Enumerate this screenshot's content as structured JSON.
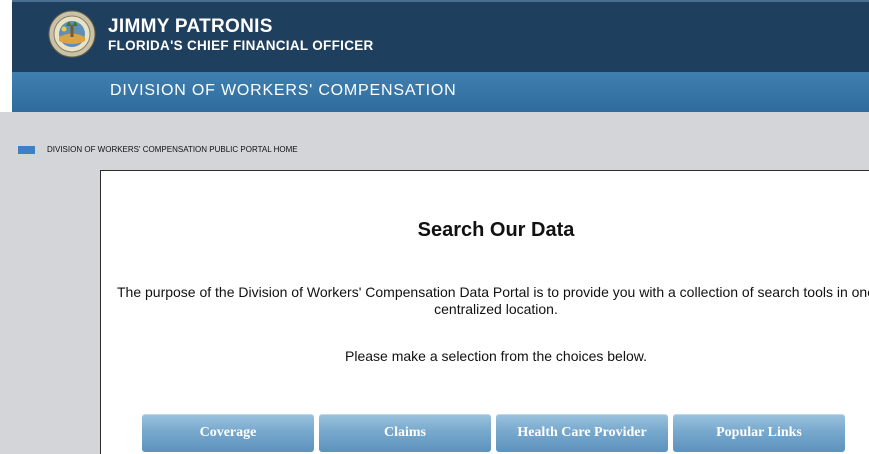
{
  "header": {
    "name": "JIMMY PATRONIS",
    "title": "FLORIDA'S CHIEF FINANCIAL OFFICER",
    "seal_icon": "florida-cfo-seal-icon",
    "background_color": "#1f3f5e"
  },
  "division": {
    "title": "DIVISION OF WORKERS' COMPENSATION",
    "background_color": "#3574a6"
  },
  "breadcrumb": {
    "label": "DIVISION OF WORKERS' COMPENSATION PUBLIC PORTAL HOME",
    "marker_color": "#3a82c4"
  },
  "content": {
    "heading": "Search Our Data",
    "purpose": "The purpose of the Division of Workers' Compensation Data Portal is to provide you with a collection of search tools in one centralized location.",
    "instruction": "Please make a selection from the choices below."
  },
  "buttons": {
    "coverage": "Coverage",
    "claims": "Claims",
    "health_care_provider": "Health Care Provider",
    "popular_links": "Popular Links"
  }
}
